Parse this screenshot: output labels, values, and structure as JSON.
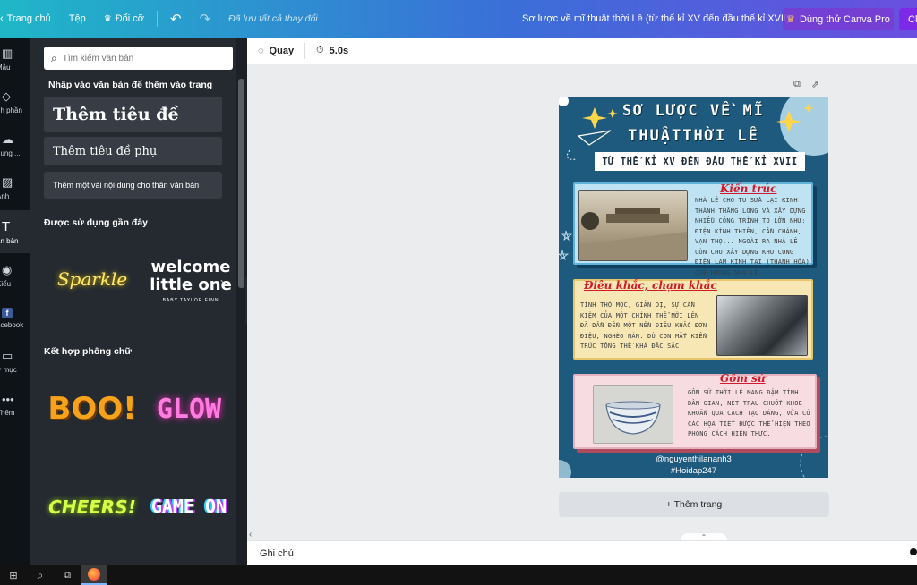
{
  "topbar": {
    "home": "Trang chủ",
    "file": "Tệp",
    "resize": "Đổi cỡ",
    "saved": "Đã lưu tất cả thay đổi",
    "doc_title": "Sơ lược về mĩ thuật thời Lê (từ thế kỉ XV đến đầu thế kỉ XVII)",
    "pro": "Dùng thử Canva Pro",
    "share_partial": "Ch"
  },
  "rail": [
    {
      "label": "Mẫu",
      "icon": "template-icon"
    },
    {
      "label": "nh phần",
      "icon": "elements-icon"
    },
    {
      "label": "dung ...",
      "icon": "upload-icon"
    },
    {
      "label": "Ảnh",
      "icon": "photo-icon"
    },
    {
      "label": "ăn bản",
      "icon": "text-icon"
    },
    {
      "label": "Kiểu",
      "icon": "palette-icon"
    },
    {
      "label": "acebook",
      "icon": "facebook-icon"
    },
    {
      "label": "ư mục",
      "icon": "folder-icon"
    },
    {
      "label": "Thêm",
      "icon": "more-icon"
    }
  ],
  "panel": {
    "search_placeholder": "Tìm kiếm văn bản",
    "click_hint": "Nhấp vào văn bản để thêm vào trang",
    "add_heading": "Thêm tiêu đề",
    "add_subheading": "Thêm tiêu đề phụ",
    "add_body": "Thêm một vài nội dung cho thân văn bản",
    "recent_title": "Được sử dụng gần đây",
    "recent": [
      {
        "text": "Sparkle"
      },
      {
        "text": "welcome little one",
        "line1": "welcome",
        "line2": "little one",
        "sub": "BABY TAYLOR FINN"
      }
    ],
    "combos_title": "Kết hợp phông chữ",
    "combos": [
      "BOO!",
      "GLOW",
      "CHEERS!",
      "GAME ON"
    ]
  },
  "context_bar": {
    "animate": "Quay",
    "duration": "5.0s"
  },
  "design": {
    "title_line1": "SƠ LƯỢC VỀ MĨ",
    "title_line2": "THUẬTTHỜI LÊ",
    "banner": "TỪ THẾ KỈ XV ĐẾN ĐẦU THẾ KỈ XVII",
    "sections": [
      {
        "heading": "Kiến trúc",
        "body": "NHÀ LÊ CHO TU SỬA LẠI KINH THÀNH THĂNG LONG VÀ XÂY DỰNG NHIỀU CÔNG TRÌNH TO LỚN NHƯ: ĐIỆN KÍNH THIÊN, CẦN CHÁNH, VẠN THỌ... NGOÀI RA NHÀ LÊ CÒN CHO XÂY DỰNG KHU CUNG ĐIỆN LAM KINH TẠI (THANH HÓA) QUÊ HƯƠNG NHÀ LÊ."
      },
      {
        "heading": "Điêu khắc, chạm khắc",
        "body": "TÍNH THÔ MỘC, GIẢN DỊ, SỰ CẦN KIỆM CỦA MỘT CHÍNH THỂ MỚI LÊN ĐÃ DẪN ĐẾN MỘT NỀN ĐIÊU KHẮC ĐƠN ĐIỆU, NGHÈO NÀN. DÙ CON MẮT KIẾN TRÚC TỔNG THỂ KHÁ ĐẮC SẮC."
      },
      {
        "heading": "Gốm sứ",
        "body": "GỐM SỨ THỜI LÊ MANG ĐẬM TÍNH DÂN GIAN, NÉT TRAU CHUỐT KHOE KHOẮN QUA CÁCH TẠO DÁNG, VỪA CÓ CÁC HỌA TIẾT ĐƯỢC THỂ HIỆN THEO PHONG CÁCH HIỆN THỰC."
      }
    ],
    "credit_user": "@nguyenthilananh3",
    "credit_tag": "#Hoidap247"
  },
  "add_page": "+ Thêm trang",
  "notes": "Ghi chú",
  "colors": {
    "design_bg": "#1e5a7e",
    "section1_bg": "#bfe3f2",
    "section2_bg": "#f6e7b4",
    "section3_bg": "#f7dde2",
    "accent_red": "#d11a2a"
  }
}
